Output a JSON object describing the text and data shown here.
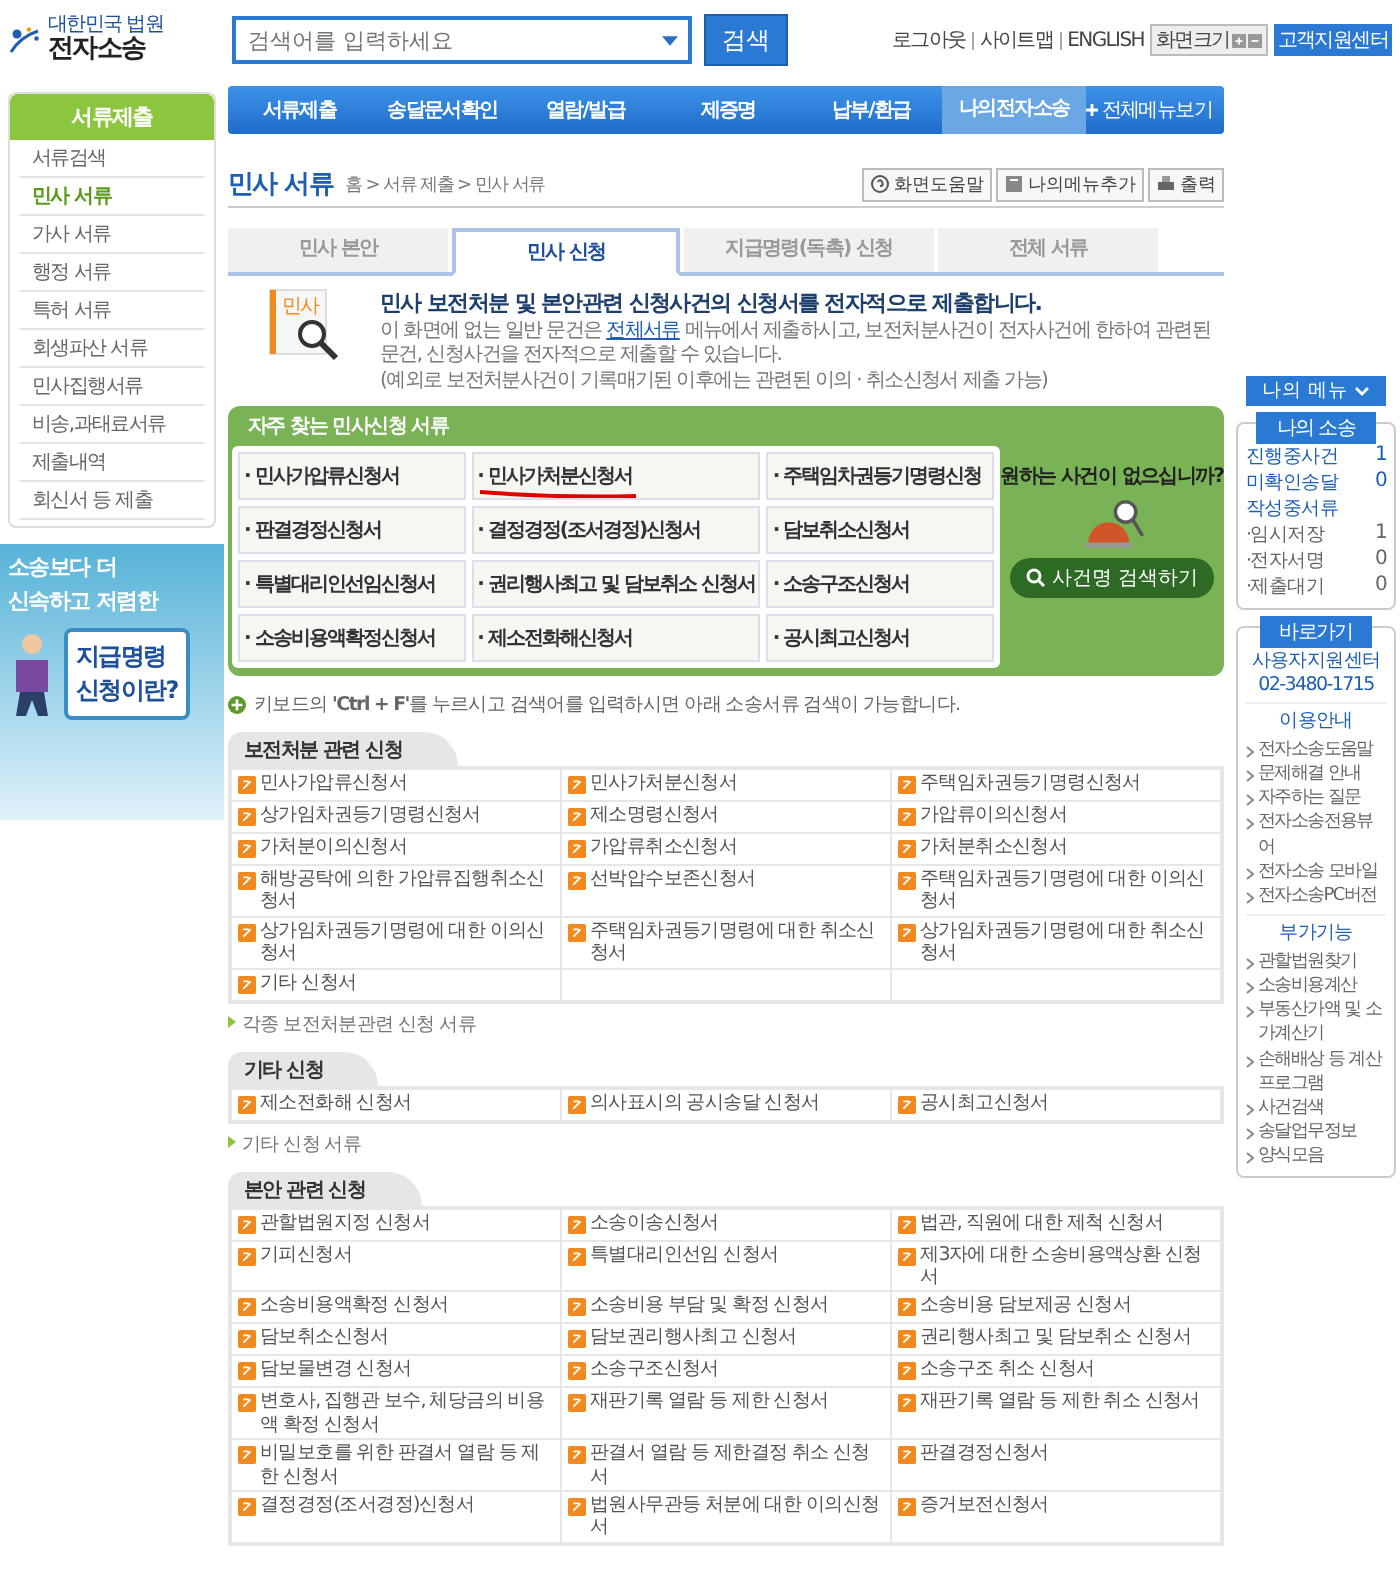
{
  "header": {
    "logo": {
      "org": "대한민국 법원",
      "name": "전자소송"
    },
    "search": {
      "placeholder": "검색어를 입력하세요",
      "button": "검색"
    },
    "util_links": [
      "로그아웃",
      "사이트맵",
      "ENGLISH"
    ],
    "font_size_label": "화면크기",
    "support": "고객지원센터"
  },
  "nav": {
    "items": [
      {
        "label": "서류제출",
        "selected": false
      },
      {
        "label": "송달문서확인",
        "selected": false
      },
      {
        "label": "열람/발급",
        "selected": false
      },
      {
        "label": "제증명",
        "selected": false
      },
      {
        "label": "납부/환급",
        "selected": false
      },
      {
        "label": "나의전자소송",
        "selected": true
      }
    ],
    "all_menu": "전체메뉴보기"
  },
  "left_menu": {
    "title": "서류제출",
    "items": [
      {
        "label": "서류검색",
        "selected": false
      },
      {
        "label": "민사 서류",
        "selected": true
      },
      {
        "label": "가사 서류",
        "selected": false
      },
      {
        "label": "행정 서류",
        "selected": false
      },
      {
        "label": "특허 서류",
        "selected": false
      },
      {
        "label": "회생파산 서류",
        "selected": false
      },
      {
        "label": "민사집행서류",
        "selected": false
      },
      {
        "label": "비송,과태료서류",
        "selected": false
      },
      {
        "label": "제출내역",
        "selected": false
      },
      {
        "label": "회신서 등 제출",
        "selected": false
      }
    ]
  },
  "banner": {
    "line1": "**소송**보다 더",
    "line2": "**신속**하고 **저렴**한",
    "card_line1": "지급명령",
    "card_line2": "신청이란?"
  },
  "page": {
    "title": "민사 서류",
    "breadcrumb": "홈 > 서류 제출 > 민사 서류",
    "tools": [
      {
        "kind": "help",
        "label": "화면도움말"
      },
      {
        "kind": "add",
        "label": "나의메뉴추가"
      },
      {
        "kind": "print",
        "label": "출력"
      }
    ]
  },
  "tabs": [
    {
      "label": "민사 본안",
      "selected": false
    },
    {
      "label": "민사 신청",
      "selected": true
    },
    {
      "label": "지급명령(독촉) 신청",
      "selected": false
    },
    {
      "label": "전체 서류",
      "selected": false
    }
  ],
  "intro": {
    "icon_label": "민사",
    "heading": "민사 보전처분 및 본안관련 신청사건의 **신청서**를 전자적으로 제출합니다.",
    "text_before": "이 화면에 없는 일반 문건은",
    "link": "전체서류",
    "text_after": "메뉴에서 제출하시고, 보전처분사건이 전자사건에 한하여 관련된 문건, 신청사건을 전자적으로 제출할 수 있습니다.",
    "note": "(예외로 보전처분사건이 기록매기된 이후에는 관련된 이의 · 취소신청서 제출 가능)"
  },
  "frequent": {
    "title": "자주 찾는 민사신청 서류",
    "items": [
      {
        "label": "· 민사가압류신청서",
        "underlined": false
      },
      {
        "label": "· 민사가처분신청서",
        "underlined": true
      },
      {
        "label": "· 주택임차권등기명령신청",
        "underlined": false
      },
      {
        "label": "· 판결경정신청서",
        "underlined": false
      },
      {
        "label": "· 결정경정(조서경정)신청서",
        "underlined": false
      },
      {
        "label": "· 담보취소신청서",
        "underlined": false
      },
      {
        "label": "· 특별대리인선임신청서",
        "underlined": false
      },
      {
        "label": "· 권리행사최고 및 담보취소 신청서",
        "underlined": false
      },
      {
        "label": "· 소송구조신청서",
        "underlined": false
      },
      {
        "label": "· 소송비용액확정신청서",
        "underlined": false
      },
      {
        "label": "· 제소전화해신청서",
        "underlined": false
      },
      {
        "label": "· 공시최고신청서",
        "underlined": false
      }
    ],
    "question": "원하는 사건이 없으십니까?",
    "search_button": "사건명 검색하기"
  },
  "tip": "키보드의 **'Ctrl + F'**를 누르시고 검색어를 입력하시면 아래 소송서류 검색이 가능합니다.",
  "sections": [
    {
      "title": "보전처분 관련 신청",
      "items": [
        "민사가압류신청서",
        "민사가처분신청서",
        "주택임차권등기명령신청서",
        "상가임차권등기명령신청서",
        "제소명령신청서",
        "가압류이의신청서",
        "가처분이의신청서",
        "가압류취소신청서",
        "가처분취소신청서",
        "해방공탁에 의한 가압류집행취소신청서",
        "선박압수보존신청서",
        "주택임차권등기명령에 대한 이의신청서",
        "상가임차권등기명령에 대한 이의신청서",
        "주택임차권등기명령에 대한 취소신청서",
        "상가임차권등기명령에 대한 취소신청서",
        "기타 신청서"
      ],
      "more": "각종 보전처분관련 신청 서류"
    },
    {
      "title": "기타 신청",
      "items": [
        "제소전화해 신청서",
        "의사표시의 공시송달 신청서",
        "공시최고신청서"
      ],
      "more": "기타 신청 서류"
    },
    {
      "title": "본안 관련 신청",
      "items": [
        "관할법원지정 신청서",
        "소송이송신청서",
        "법관, 직원에 대한 제척 신청서",
        "기피신청서",
        "특별대리인선임 신청서",
        "제3자에 대한 소송비용액상환 신청서",
        "소송비용액확정 신청서",
        "소송비용 부담 및 확정 신청서",
        "소송비용 담보제공 신청서",
        "담보취소신청서",
        "담보권리행사최고 신청서",
        "권리행사최고 및 담보취소 신청서",
        "담보물변경 신청서",
        "소송구조신청서",
        "소송구조 취소 신청서",
        "변호사, 집행관 보수, 체당금의 비용액 확정 신청서",
        "재판기록 열람 등 제한 신청서",
        "재판기록 열람 등 제한 취소 신청서",
        "비밀보호를 위한 판결서 열람 등 제한 신청서",
        "판결서 열람 등 제한결정 취소 신청서",
        "판결경정신청서",
        "결정경정(조서경정)신청서",
        "법원사무관등 처분에 대한 이의신청서",
        "증거보전신청서"
      ]
    }
  ],
  "right": {
    "my_menu": "나의 메뉴",
    "my_case": {
      "title": "나의 소송",
      "rows": [
        {
          "kind": "main",
          "label": "진행중사건",
          "count": "1"
        },
        {
          "kind": "main",
          "label": "미확인송달",
          "count": "0"
        },
        {
          "kind": "main",
          "label": "작성중서류"
        },
        {
          "kind": "sub",
          "label": "·임시저장",
          "count": "1"
        },
        {
          "kind": "sub",
          "label": "·전자서명",
          "count": "0"
        },
        {
          "kind": "sub",
          "label": "·제출대기",
          "count": "0"
        }
      ]
    },
    "shortcuts": {
      "title": "바로가기",
      "center": "사용자지원센터",
      "phone": "02-3480-1715",
      "groups": [
        {
          "title": "이용안내",
          "links": [
            "전자소송도움말",
            "문제해결 안내",
            "자주하는 질문",
            "전자소송전용뷰어",
            "전자소송 모바일",
            "전자소송PC버전"
          ]
        },
        {
          "title": "부가기능",
          "links": [
            "관할법원찾기",
            "소송비용계산",
            "부동산가액 및 소가계산기",
            "손해배상 등 계산 프로그램",
            "사건검색",
            "송달업무정보",
            "양식모음"
          ]
        }
      ]
    }
  }
}
